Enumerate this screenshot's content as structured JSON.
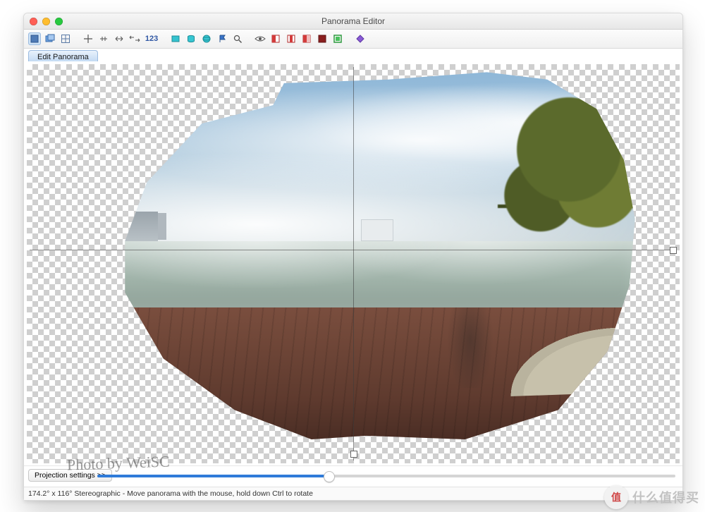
{
  "window": {
    "title": "Panorama Editor"
  },
  "toolbar": {
    "items": [
      {
        "name": "select-tool-icon",
        "selected": true
      },
      {
        "name": "layers-icon"
      },
      {
        "name": "grid-icon"
      },
      {
        "name": "crosshair-icon"
      },
      {
        "name": "center-horizontal-icon"
      },
      {
        "name": "arrows-horizontal-icon"
      },
      {
        "name": "double-arrows-horizontal-icon"
      },
      {
        "name": "numeric-123",
        "text": "123"
      },
      {
        "name": "rectangle-cyan-icon"
      },
      {
        "name": "cylinder-icon"
      },
      {
        "name": "sphere-icon"
      },
      {
        "name": "flag-blue-icon"
      },
      {
        "name": "magnifier-icon"
      },
      {
        "name": "eye-icon"
      },
      {
        "name": "mask-red-left-icon"
      },
      {
        "name": "mask-red-center-icon"
      },
      {
        "name": "mask-split-icon"
      },
      {
        "name": "mask-red-dark-icon"
      },
      {
        "name": "crop-green-icon"
      },
      {
        "name": "diamond-purple-icon"
      }
    ]
  },
  "tabs": {
    "active": "Edit Panorama"
  },
  "controls": {
    "projection_button": "Projection settings >>",
    "slider_percent": 40
  },
  "status": {
    "text": "174.2° x 116° Stereographic - Move panorama with the mouse, hold down Ctrl to rotate"
  },
  "signature": "Photo by WeiSC",
  "watermark": {
    "badge": "值",
    "text": "什么值得买"
  }
}
